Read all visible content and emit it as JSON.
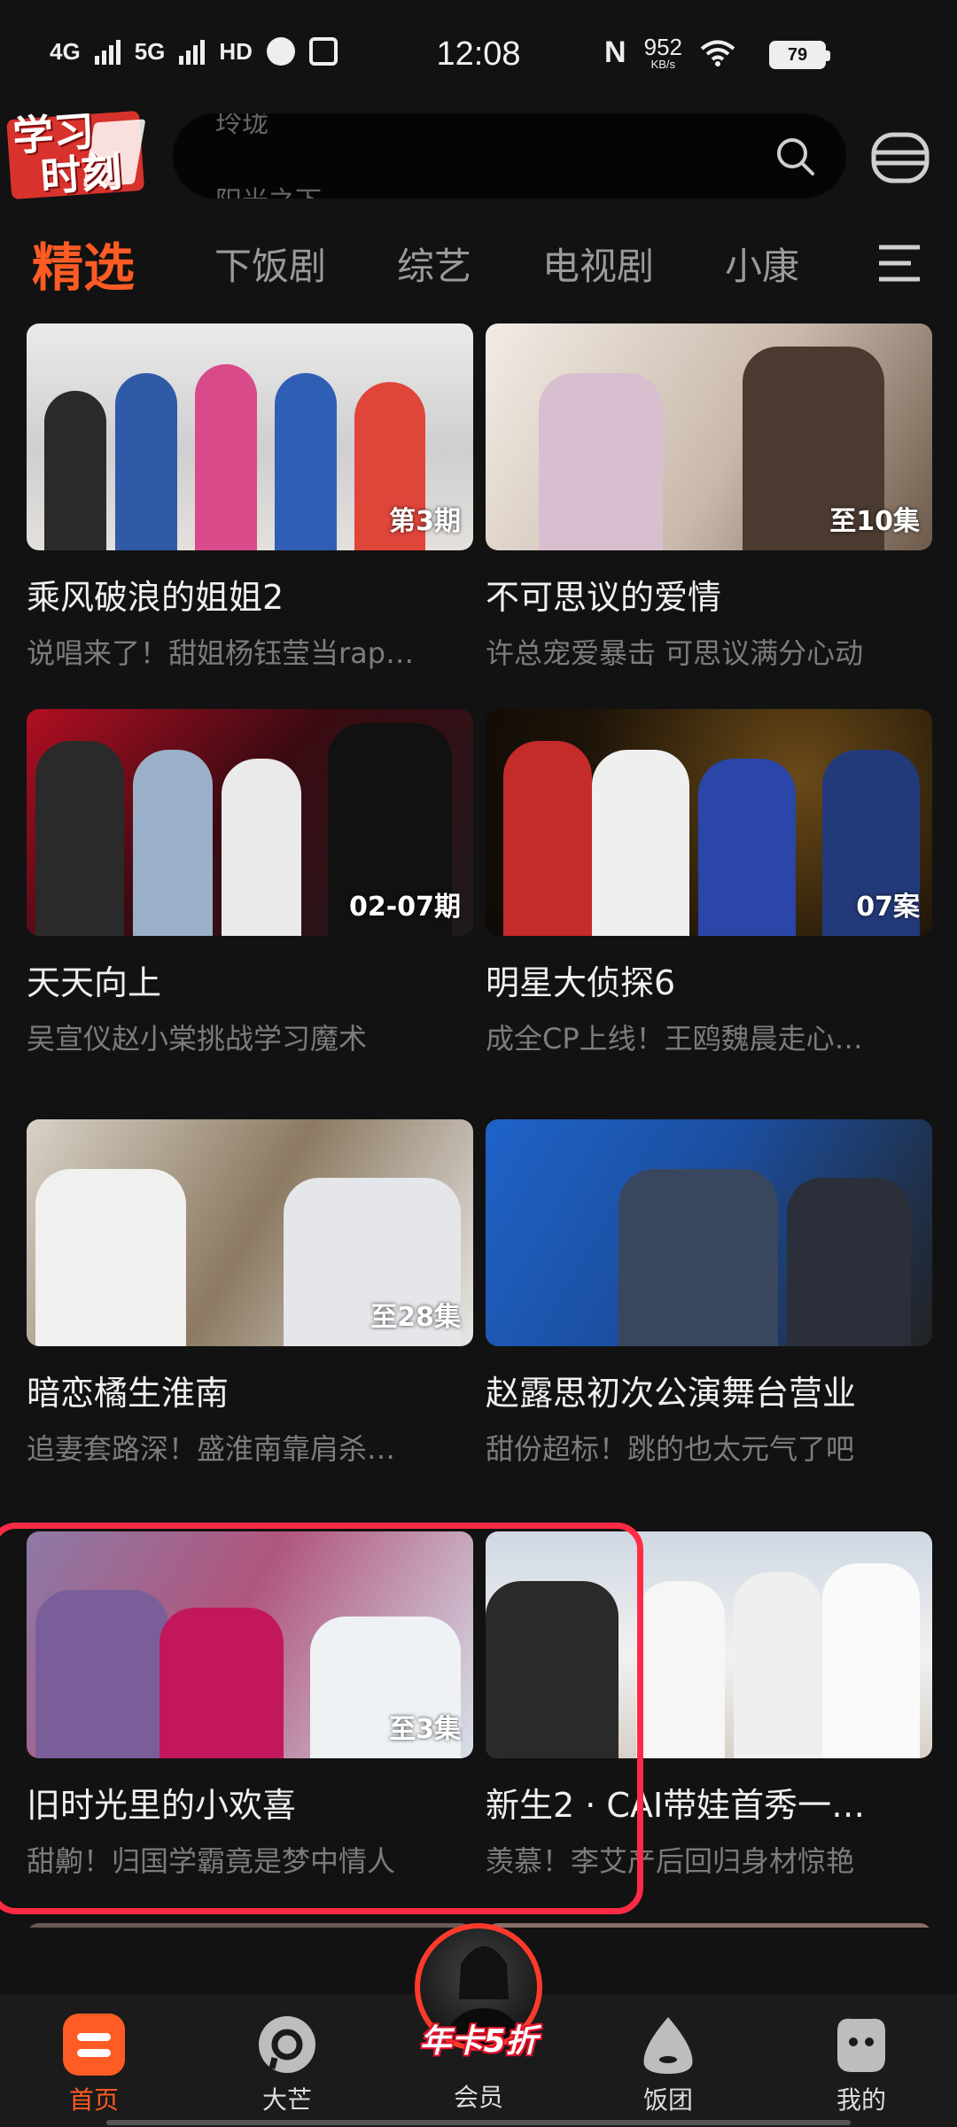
{
  "status_bar": {
    "network1": "4G",
    "network2": "5G",
    "hd": "HD",
    "time": "12:08",
    "nfc": "N",
    "speed_value": "952",
    "speed_unit": "KB/s",
    "battery": "79"
  },
  "header": {
    "logo_line1": "学习",
    "logo_line2": "时刻",
    "search_hint_prev": "玲珑",
    "search_hint_next": "阳光之下"
  },
  "tabs": [
    "精选",
    "下饭剧",
    "综艺",
    "电视剧",
    "小康"
  ],
  "cards": [
    {
      "badge": "第3期",
      "title": "乘风破浪的姐姐2",
      "subtitle": "说唱来了！甜姐杨钰莹当rap…"
    },
    {
      "badge": "至10集",
      "title": "不可思议的爱情",
      "subtitle": "许总宠爱暴击 可思议满分心动"
    },
    {
      "badge": "02-07期",
      "title": "天天向上",
      "subtitle": "吴宣仪赵小棠挑战学习魔术"
    },
    {
      "badge": "07案",
      "title": "明星大侦探6",
      "subtitle": "成全CP上线！王鸥魏晨走心…"
    },
    {
      "badge": "至28集",
      "title": "暗恋橘生淮南",
      "subtitle": "追妻套路深！盛淮南靠肩杀…"
    },
    {
      "badge": "",
      "title": "赵露思初次公演舞台营业",
      "subtitle": "甜份超标！跳的也太元气了吧"
    },
    {
      "badge": "至3集",
      "title": "旧时光里的小欢喜",
      "subtitle": "甜齁！归国学霸竟是梦中情人"
    },
    {
      "badge": "",
      "title": "新生2 · CAI带娃首秀一…",
      "subtitle": "羡慕！李艾产后回归身材惊艳"
    }
  ],
  "bottom_nav": {
    "home": "首页",
    "mango": "大芒",
    "vip": "会员",
    "vip_promo": "年卡5折",
    "fantuan": "饭团",
    "mine": "我的"
  },
  "colors": {
    "accent": "#ff5b24",
    "highlight": "#ff2b45",
    "background": "#121212"
  }
}
